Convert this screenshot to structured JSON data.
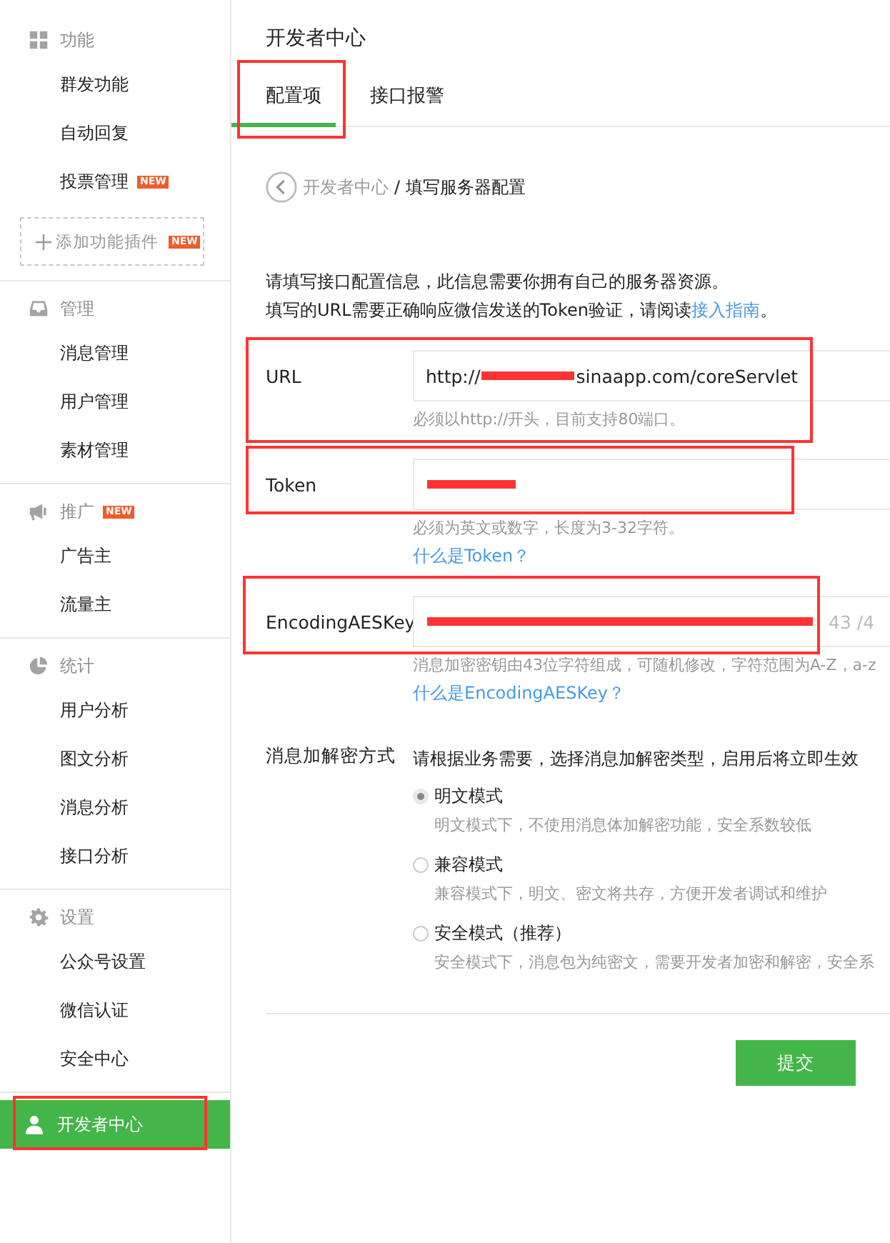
{
  "sidebar": {
    "sections": [
      {
        "title": "功能",
        "items": [
          {
            "label": "群发功能",
            "selected": false
          },
          {
            "label": "自动回复",
            "selected": false
          },
          {
            "label": "投票管理",
            "selected": false,
            "badge": "NEW"
          }
        ],
        "add_button": {
          "label": "添加功能插件",
          "badge": "NEW"
        }
      },
      {
        "title": "管理",
        "items": [
          {
            "label": "消息管理",
            "selected": false
          },
          {
            "label": "用户管理",
            "selected": false
          },
          {
            "label": "素材管理",
            "selected": false
          }
        ]
      },
      {
        "title": "推广",
        "badge": "NEW",
        "items": [
          {
            "label": "广告主",
            "selected": false
          },
          {
            "label": "流量主",
            "selected": false
          }
        ]
      },
      {
        "title": "统计",
        "items": [
          {
            "label": "用户分析",
            "selected": false
          },
          {
            "label": "图文分析",
            "selected": false
          },
          {
            "label": "消息分析",
            "selected": false
          },
          {
            "label": "接口分析",
            "selected": false
          }
        ]
      },
      {
        "title": "设置",
        "items": [
          {
            "label": "公众号设置",
            "selected": false
          },
          {
            "label": "微信认证",
            "selected": false
          },
          {
            "label": "安全中心",
            "selected": false
          }
        ]
      },
      {
        "items": [
          {
            "label": "开发者中心",
            "selected": true,
            "annotated": true
          }
        ]
      }
    ]
  },
  "page_title": "开发者中心",
  "tabs": [
    {
      "label": "配置项",
      "selected": true,
      "annotated": true
    },
    {
      "label": "接口报警",
      "selected": false,
      "annotated": false
    }
  ],
  "breadcrumb": {
    "parent": "开发者中心",
    "separator": "/",
    "current": "填写服务器配置"
  },
  "intro": [
    "请填写接口配置信息，此信息需要你拥有自己的服务器资源。",
    "填写的URL需要正确响应微信发送的Token验证，请阅读"
  ],
  "intro_link": "接入指南",
  "intro_end": "。",
  "fields": [
    {
      "label": "URL",
      "value_before": "http://",
      "redacted": true,
      "value_after": "sinaapp.com/coreServlet",
      "annotated": true,
      "hint": "必须以http://开头，目前支持80端口。"
    },
    {
      "label": "Token",
      "redacted": true,
      "annotated": true,
      "hint": "必须为英文或数字，长度为3-32字符。",
      "link": "什么是Token？"
    },
    {
      "label": "EncodingAESKey",
      "redacted": true,
      "counter": "43 /4",
      "annotated": true,
      "hint": "消息加密密钥由43位字符组成，可随机修改，字符范围为A-Z，a-z",
      "link": "什么是EncodingAESKey？"
    }
  ],
  "encryption": {
    "label": "消息加解密方式",
    "description": "请根据业务需要，选择消息加解密类型，启用后将立即生效",
    "options": [
      {
        "label": "明文模式",
        "selected": true,
        "hint": "明文模式下，不使用消息体加解密功能，安全系数较低"
      },
      {
        "label": "兼容模式",
        "selected": false,
        "hint": "兼容模式下，明文、密文将共存，方便开发者调试和维护"
      },
      {
        "label": "安全模式（推荐）",
        "selected": false,
        "hint": "安全模式下，消息包为纯密文，需要开发者加密和解密，安全系"
      }
    ]
  },
  "submit": "提交"
}
